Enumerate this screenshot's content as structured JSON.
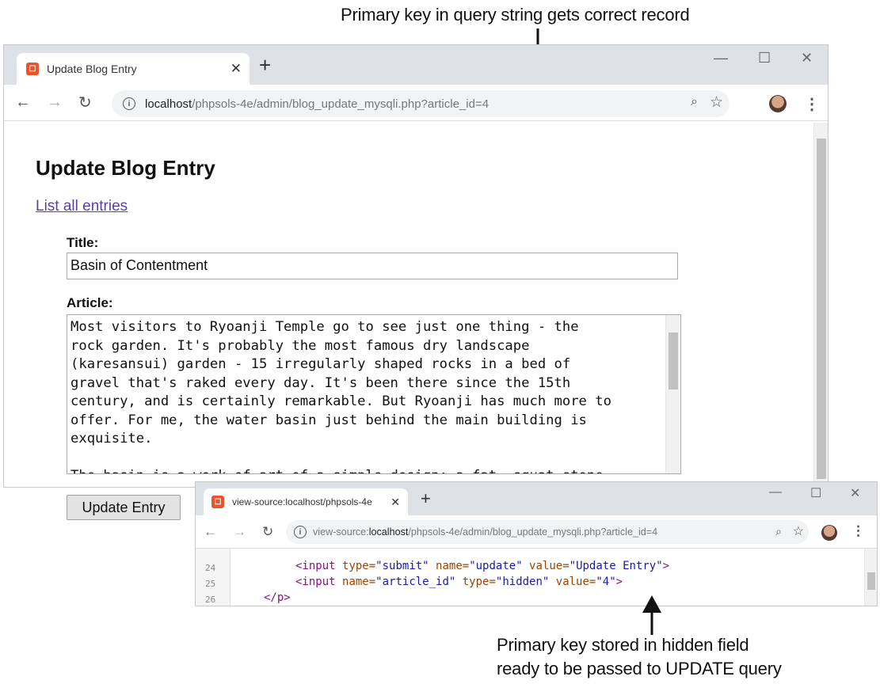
{
  "callouts": {
    "top": "Primary key in query string gets correct record",
    "bottom_line1": "Primary key stored in hidden field",
    "bottom_line2": "ready to be passed to UPDATE query"
  },
  "window_main": {
    "tab_title": "Update Blog Entry",
    "url_host": "localhost",
    "url_path": "/phpsols-4e/admin/blog_update_mysqli.php?article_id=4",
    "heading": "Update Blog Entry",
    "link_text": "List all entries",
    "title_label": "Title:",
    "title_value": "Basin of Contentment",
    "article_label": "Article:",
    "article_text": "Most visitors to Ryoanji Temple go to see just one thing - the\nrock garden. It's probably the most famous dry landscape\n(karesansui) garden - 15 irregularly shaped rocks in a bed of\ngravel that's raked every day. It's been there since the 15th\ncentury, and is certainly remarkable. But Ryoanji has much more to\noffer. For me, the water basin just behind the main building is\nexquisite.\n\nThe basin is a work of art of a simple design: a fat, squat stone",
    "button_label": "Update Entry"
  },
  "window_source": {
    "tab_title": "view-source:localhost/phpsols-4e",
    "url_prefix": "view-source:",
    "url_host": "localhost",
    "url_path": "/phpsols-4e/admin/blog_update_mysqli.php?article_id=4",
    "lines": [
      {
        "num": "24",
        "tag_open": "<input ",
        "a1": "type=",
        "v1": "\"submit\"",
        "a2": " name=",
        "v2": "\"update\"",
        "a3": " value=",
        "v3": "\"Update Entry\"",
        "tag_close": ">"
      },
      {
        "num": "25",
        "tag_open": "<input ",
        "a1": "name=",
        "v1": "\"article_id\"",
        "a2": " type=",
        "v2": "\"hidden\"",
        "a3": " value=",
        "v3": "\"4\"",
        "tag_close": ">"
      },
      {
        "num": "26",
        "tag_open": "</p>"
      }
    ]
  },
  "icons": {
    "back": "back-arrow-icon",
    "forward": "forward-arrow-icon",
    "reload": "reload-icon",
    "info": "info-icon",
    "zoom": "zoom-icon",
    "star": "bookmark-star-icon",
    "menu": "kebab-menu-icon"
  },
  "colors": {
    "link": "#5b3fa8",
    "favicon": "#e8542c",
    "tag": "#881280",
    "attr": "#994500",
    "val": "#1a1aa6"
  }
}
